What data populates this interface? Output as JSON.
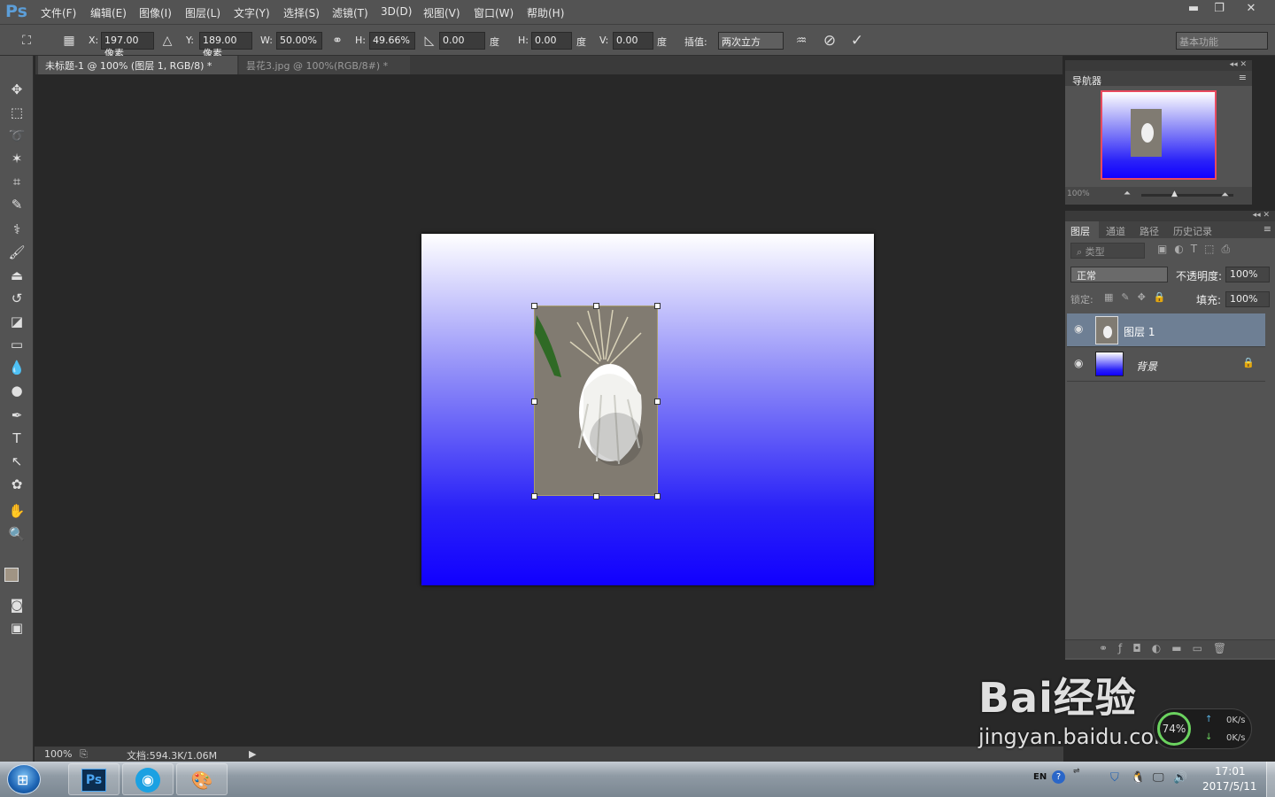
{
  "app": {
    "logo": "Ps"
  },
  "menu": {
    "items": [
      "文件(F)",
      "编辑(E)",
      "图像(I)",
      "图层(L)",
      "文字(Y)",
      "选择(S)",
      "滤镜(T)",
      "3D(D)",
      "视图(V)",
      "窗口(W)",
      "帮助(H)"
    ]
  },
  "window_controls": {
    "minimize": "▬",
    "restore": "❐",
    "close": "✕"
  },
  "options": {
    "x_label": "X:",
    "x_value": "197.00 像素",
    "y_label": "Y:",
    "y_value": "189.00 像素",
    "w_label": "W:",
    "w_value": "50.00%",
    "h_label": "H:",
    "h_value": "49.66%",
    "angle_value": "0.00",
    "angle_unit": "度",
    "hskew_label": "H:",
    "hskew_value": "0.00",
    "hskew_unit": "度",
    "vskew_label": "V:",
    "vskew_value": "0.00",
    "vskew_unit": "度",
    "interp_label": "插值:",
    "interp_value": "两次立方",
    "workspace": "基本功能"
  },
  "tabs": [
    {
      "label": "未标题-1 @ 100% (图层 1, RGB/8) *",
      "close": "×"
    },
    {
      "label": "昙花3.jpg @ 100%(RGB/8#) *",
      "close": "×"
    }
  ],
  "status": {
    "zoom": "100%",
    "doc": "文档:594.3K/1.06M"
  },
  "navigator": {
    "title": "导航器",
    "zoom": "100%"
  },
  "layers_panel": {
    "tabs": [
      "图层",
      "通道",
      "路径",
      "历史记录"
    ],
    "filter_placeholder": "类型",
    "blend_mode": "正常",
    "opacity_label": "不透明度:",
    "opacity_value": "100%",
    "lock_label": "锁定:",
    "fill_label": "填充:",
    "fill_value": "100%",
    "layers": [
      {
        "name": "图层 1",
        "selected": true
      },
      {
        "name": "背景",
        "selected": false
      }
    ]
  },
  "taskbar": {
    "lang": "EN",
    "time": "17:01",
    "date": "2017/5/11"
  },
  "netmon": {
    "up": "0K/s",
    "down": "0K/s",
    "percent": "74%"
  },
  "watermark": {
    "line1": "Bai经验",
    "line2": "jingyan.baidu.com"
  },
  "colors": {
    "accent": "#5c9ed8",
    "canvas_bottom": "#1100ff",
    "layer_selected": "#6e7f94"
  }
}
